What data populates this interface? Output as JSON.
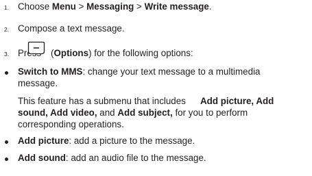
{
  "steps": [
    {
      "num": "1.",
      "pre": "Choose ",
      "b1": "Menu",
      "sep1": " > ",
      "b2": "Messaging",
      "sep2": " > ",
      "b3": "Write message",
      "end": "."
    },
    {
      "num": "2.",
      "text": "Compose a text message."
    },
    {
      "num": "3.",
      "pre": "Press",
      "paren_open": "(",
      "bold": "Options",
      "post": ") for the following options:"
    }
  ],
  "key_icon": "left-soft-key-icon",
  "options": [
    {
      "bold": "Switch to MMS",
      "text_line1": ": change your text message to a multimedia",
      "text_line2": "message."
    },
    {
      "bold": "Add picture",
      "text": ": add a picture to the message."
    },
    {
      "bold": "Add sound",
      "text": ": add an audio file to the message."
    }
  ],
  "submenu_note": {
    "pre": "This feature has a submenu that includes ",
    "b1": "Add picture, Add",
    "b2": "sound, Add video,",
    "mid": " and ",
    "b3": "Add subject,",
    "post": " for you to perform",
    "line3": "corresponding operations."
  }
}
